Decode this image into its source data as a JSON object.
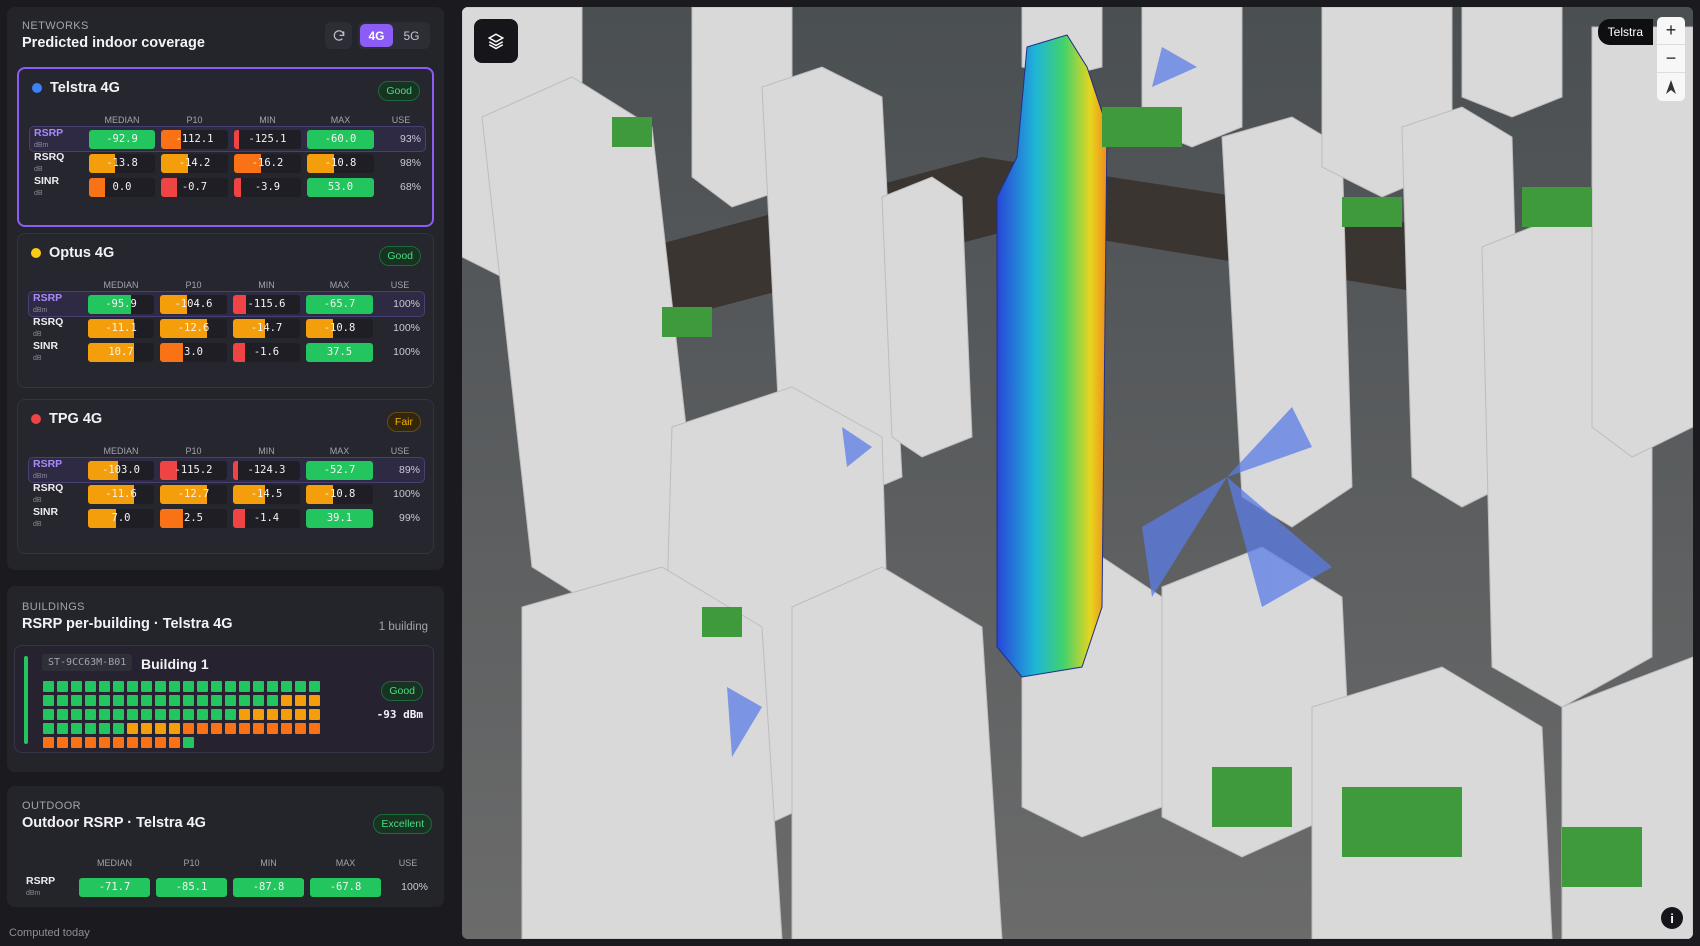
{
  "networks": {
    "section_label": "NETWORKS",
    "title": "Predicted indoor coverage",
    "toggle_4g": "4G",
    "toggle_5g": "5G",
    "columns": [
      "MEDIAN",
      "P10",
      "MIN",
      "MAX",
      "USE"
    ],
    "cards": [
      {
        "name": "Telstra 4G",
        "dot_color": "#3b82f6",
        "status": "Good",
        "rows": [
          {
            "metric": "RSRP",
            "unit": "dBm",
            "median": "-92.9",
            "p10": "-112.1",
            "min": "-125.1",
            "max": "-60.0",
            "use": "93%"
          },
          {
            "metric": "RSRQ",
            "unit": "dB",
            "median": "-13.8",
            "p10": "-14.2",
            "min": "-16.2",
            "max": "-10.8",
            "use": "98%"
          },
          {
            "metric": "SINR",
            "unit": "dB",
            "median": "0.0",
            "p10": "-0.7",
            "min": "-3.9",
            "max": "53.0",
            "use": "68%"
          }
        ]
      },
      {
        "name": "Optus 4G",
        "dot_color": "#facc15",
        "status": "Good",
        "rows": [
          {
            "metric": "RSRP",
            "unit": "dBm",
            "median": "-95.9",
            "p10": "-104.6",
            "min": "-115.6",
            "max": "-65.7",
            "use": "100%"
          },
          {
            "metric": "RSRQ",
            "unit": "dB",
            "median": "-11.1",
            "p10": "-12.6",
            "min": "-14.7",
            "max": "-10.8",
            "use": "100%"
          },
          {
            "metric": "SINR",
            "unit": "dB",
            "median": "10.7",
            "p10": "3.0",
            "min": "-1.6",
            "max": "37.5",
            "use": "100%"
          }
        ]
      },
      {
        "name": "TPG 4G",
        "dot_color": "#ef4444",
        "status": "Fair",
        "rows": [
          {
            "metric": "RSRP",
            "unit": "dBm",
            "median": "-103.0",
            "p10": "-115.2",
            "min": "-124.3",
            "max": "-52.7",
            "use": "89%"
          },
          {
            "metric": "RSRQ",
            "unit": "dB",
            "median": "-11.6",
            "p10": "-12.7",
            "min": "-14.5",
            "max": "-10.8",
            "use": "100%"
          },
          {
            "metric": "SINR",
            "unit": "dB",
            "median": "7.0",
            "p10": "2.5",
            "min": "-1.4",
            "max": "39.1",
            "use": "99%"
          }
        ]
      }
    ]
  },
  "buildings": {
    "section_label": "BUILDINGS",
    "title": "RSRP per-building · Telstra 4G",
    "count": "1 building",
    "building": {
      "id": "ST-9CC63M-B01",
      "name": "Building 1",
      "status": "Good",
      "value": "-93 dBm"
    }
  },
  "outdoor": {
    "section_label": "OUTDOOR",
    "title": "Outdoor RSRP · Telstra 4G",
    "status": "Excellent",
    "columns": [
      "MEDIAN",
      "P10",
      "MIN",
      "MAX",
      "USE"
    ],
    "row": {
      "metric": "RSRP",
      "unit": "dBm",
      "median": "-71.7",
      "p10": "-85.1",
      "min": "-87.8",
      "max": "-67.8",
      "use": "100%"
    }
  },
  "footer": "Computed today",
  "map": {
    "chip_label": "Telstra",
    "zoom_in": "+",
    "zoom_out": "−",
    "info": "i"
  },
  "colors": {
    "accent": "#8b5cf6",
    "good": "#22c55e",
    "amber": "#f59e0b",
    "orange": "#f97316",
    "red": "#ef4444"
  }
}
